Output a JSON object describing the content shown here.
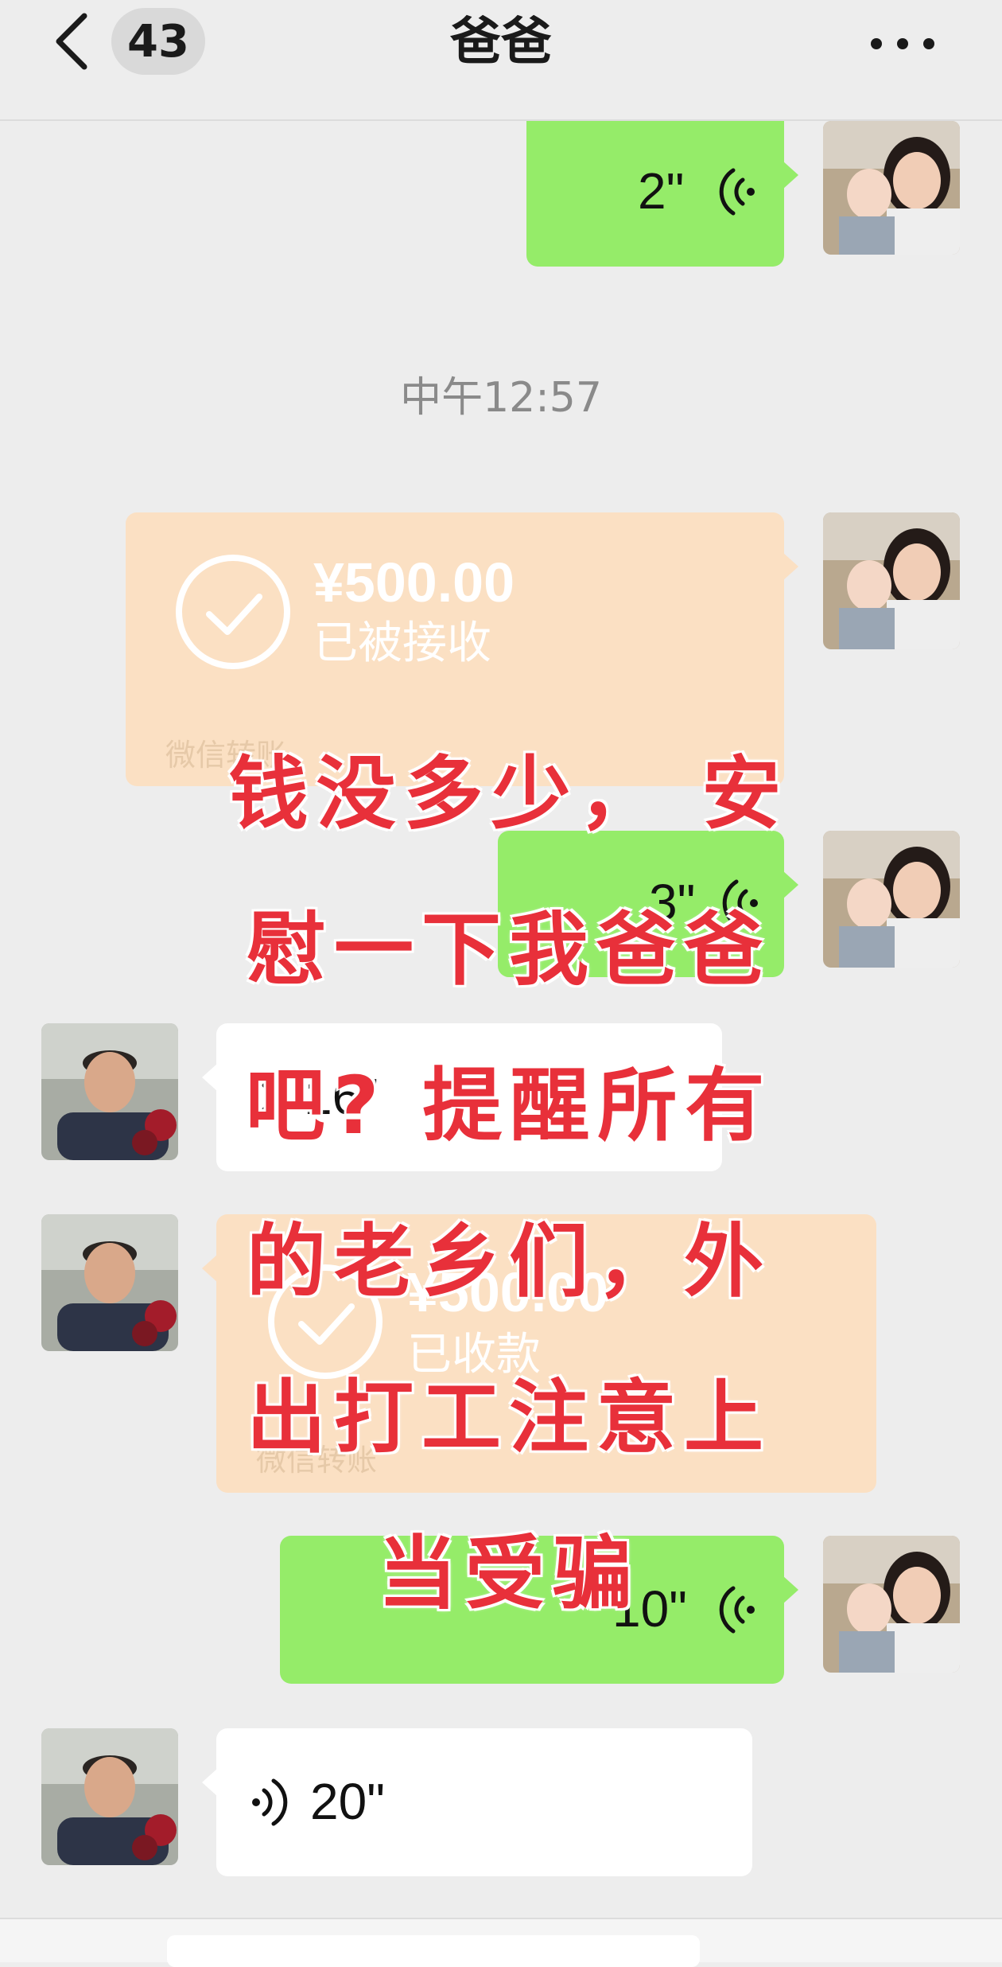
{
  "header": {
    "back_badge_count": "43",
    "title": "爸爸"
  },
  "messages": {
    "m1": {
      "duration": "2\""
    },
    "timestamp": "中午12:57",
    "m2": {
      "amount": "¥500.00",
      "status": "已被接收",
      "footer": "微信转账"
    },
    "m3": {
      "duration": "3\""
    },
    "m4": {
      "duration": "16\""
    },
    "m5": {
      "amount": "¥500.00",
      "status": "已收款",
      "footer": "微信转账"
    },
    "m6": {
      "duration": "10\""
    },
    "m7": {
      "duration": "20\""
    }
  },
  "overlay_caption": "钱没多少， 安慰一下我爸爸吧? 提醒所有的老乡们，外出打工注意上当受骗",
  "colors": {
    "sent_bubble": "#95ec69",
    "received_bubble": "#ffffff",
    "transfer_bubble": "#fbe0c3",
    "overlay_text": "#e8303a",
    "background": "#ededed"
  },
  "icons": [
    "back-chevron-icon",
    "more-icon",
    "voice-icon",
    "check-circle-icon"
  ]
}
